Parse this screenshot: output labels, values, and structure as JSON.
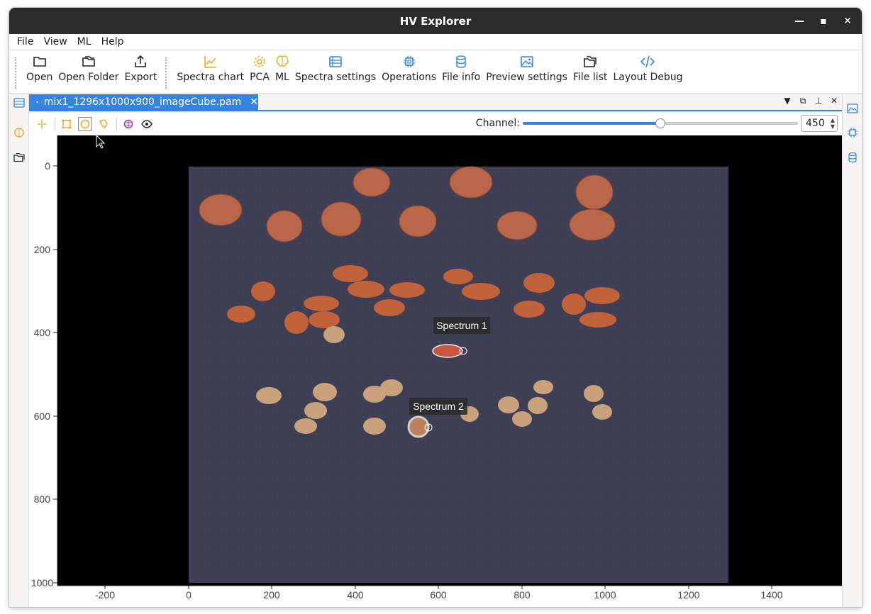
{
  "window": {
    "title": "HV Explorer"
  },
  "menu": [
    "File",
    "View",
    "ML",
    "Help"
  ],
  "toolbar": {
    "open": "Open",
    "open_folder": "Open Folder",
    "export": "Export",
    "spectra_chart": "Spectra chart",
    "pca": "PCA",
    "ml": "ML",
    "spectra_settings": "Spectra settings",
    "operations": "Operations",
    "file_info": "File info",
    "preview_settings": "Preview settings",
    "file_list": "File list",
    "layout_debug": "Layout Debug"
  },
  "tab": {
    "title": "mix1_1296x1000x900_imageCube.pam",
    "close": "✕"
  },
  "channel": {
    "label": "Channel:",
    "value": "450",
    "fraction": 0.5
  },
  "axes": {
    "x_ticks": [
      "-200",
      "0",
      "200",
      "400",
      "600",
      "800",
      "1000",
      "1200",
      "1400"
    ],
    "y_ticks": [
      "0",
      "200",
      "400",
      "600",
      "800",
      "1000"
    ]
  },
  "annotations": {
    "spectrum1": "Spectrum 1",
    "spectrum2": "Spectrum 2"
  },
  "colors": {
    "accent": "#3584e4",
    "orange_icon": "#f5a623",
    "image_bg": "#3e3f55",
    "nut_orange": "#c1623a"
  }
}
